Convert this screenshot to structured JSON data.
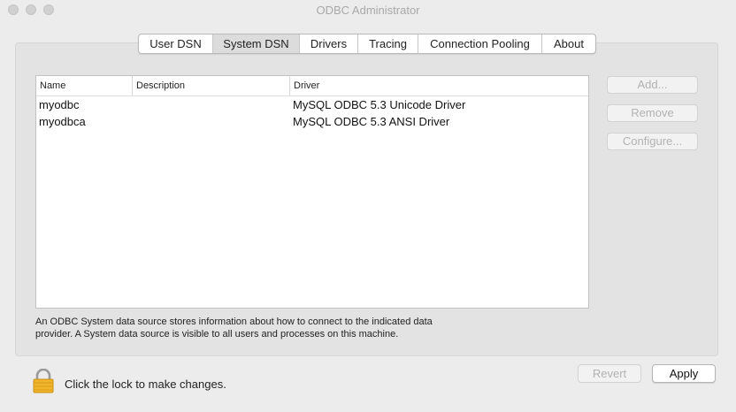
{
  "window": {
    "title": "ODBC Administrator"
  },
  "tabs": [
    {
      "label": "User DSN"
    },
    {
      "label": "System DSN",
      "selected": true
    },
    {
      "label": "Drivers"
    },
    {
      "label": "Tracing"
    },
    {
      "label": "Connection Pooling"
    },
    {
      "label": "About"
    }
  ],
  "table": {
    "columns": [
      "Name",
      "Description",
      "Driver"
    ],
    "rows": [
      {
        "name": "myodbc",
        "description": "",
        "driver": "MySQL ODBC 5.3 Unicode Driver"
      },
      {
        "name": "myodbca",
        "description": "",
        "driver": "MySQL ODBC 5.3 ANSI Driver"
      }
    ]
  },
  "side_buttons": {
    "add": "Add...",
    "remove": "Remove",
    "configure": "Configure..."
  },
  "description": {
    "line1": "An ODBC System data source stores information about how to connect to the indicated data",
    "line2": "provider. A System data source is visible to all users and processes on this machine."
  },
  "footer": {
    "lock_label": "Click the lock to make changes.",
    "revert_label": "Revert",
    "apply_label": "Apply"
  },
  "icons": {
    "lock": "lock-icon"
  },
  "colors": {
    "window_bg": "#ececec",
    "panel_bg": "#e3e3e3",
    "lock_gold": "#f0b52a"
  }
}
